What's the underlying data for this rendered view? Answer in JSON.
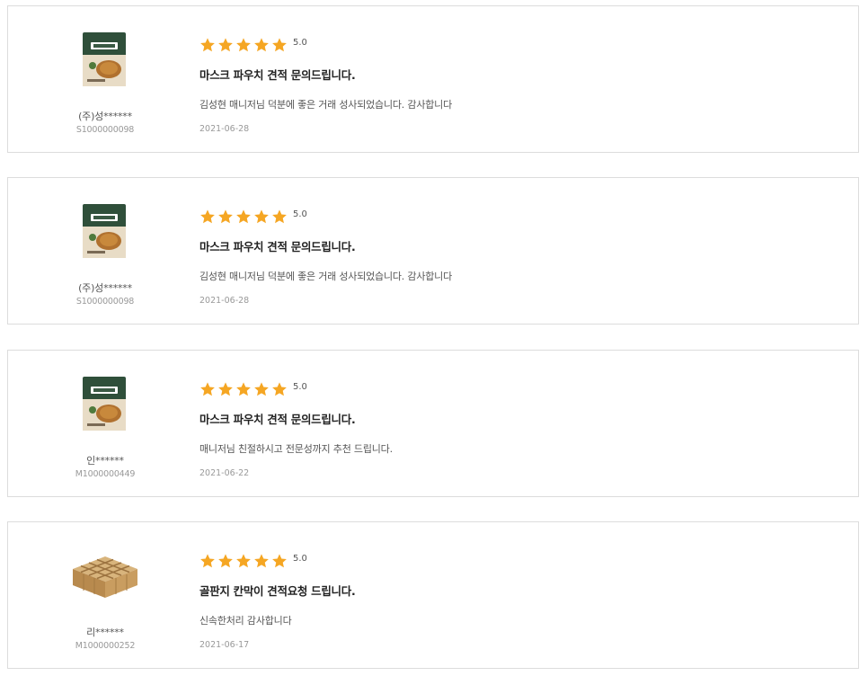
{
  "reviews": [
    {
      "product_image": "pork-cutlet-package",
      "reviewer": "(주)성******",
      "reviewer_id": "S1000000098",
      "stars": 5,
      "score": "5.0",
      "title": "마스크 파우치 견적 문의드립니다.",
      "body": "김성현 매니저님 덕분에 좋은 거래 성사되었습니다. 감사합니다",
      "date": "2021-06-28"
    },
    {
      "product_image": "pork-cutlet-package",
      "reviewer": "(주)성******",
      "reviewer_id": "S1000000098",
      "stars": 5,
      "score": "5.0",
      "title": "마스크 파우치 견적 문의드립니다.",
      "body": "김성현 매니저님 덕분에 좋은 거래 성사되었습니다. 감사합니다",
      "date": "2021-06-28"
    },
    {
      "product_image": "pork-cutlet-package",
      "reviewer": "인******",
      "reviewer_id": "M1000000449",
      "stars": 5,
      "score": "5.0",
      "title": "마스크 파우치 견적 문의드립니다.",
      "body": "매니저님 친절하시고 전문성까지 추천 드립니다.",
      "date": "2021-06-22"
    },
    {
      "product_image": "cardboard-partition",
      "reviewer": "리******",
      "reviewer_id": "M1000000252",
      "stars": 5,
      "score": "5.0",
      "title": "골판지 칸막이 견적요청 드립니다.",
      "body": "신속한처리 감사합니다",
      "date": "2021-06-17"
    }
  ],
  "colors": {
    "star": "#f5a623",
    "border": "#dcdcdc",
    "package_green": "#2f4f3a",
    "cardboard": "#c9a16a"
  }
}
